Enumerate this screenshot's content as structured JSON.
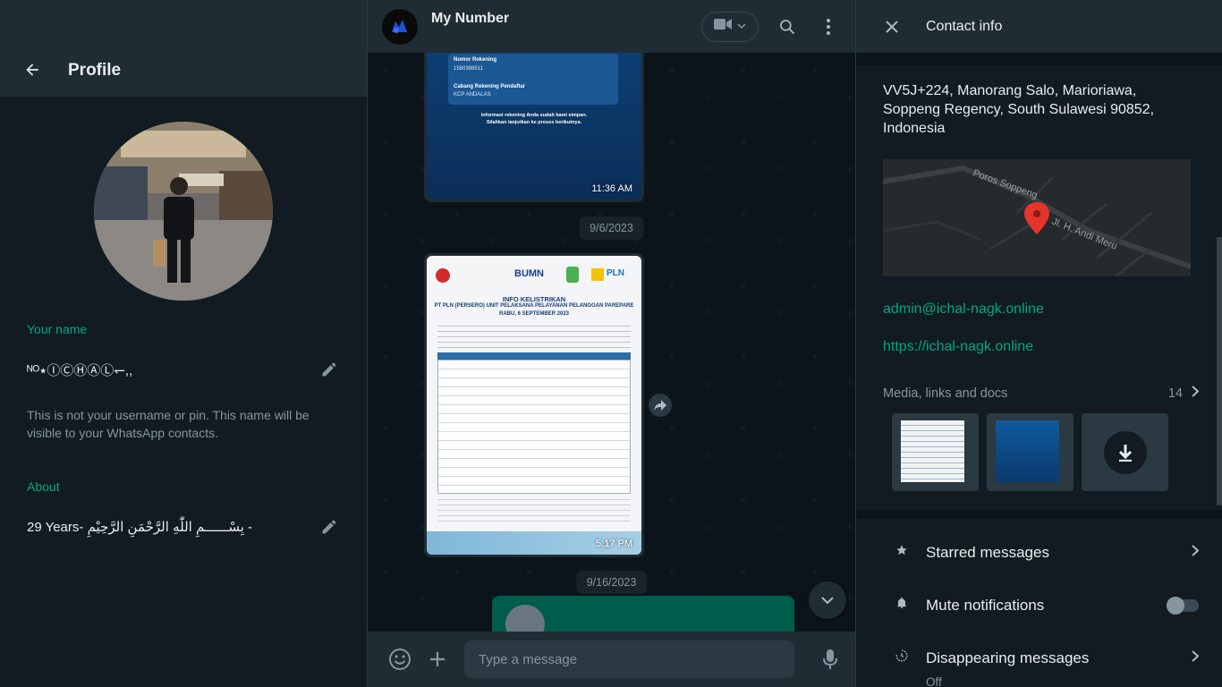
{
  "profile": {
    "title": "Profile",
    "name_label": "Your name",
    "name_value": "ᴺᴼ٭ⒾⒸⒽⒶⓁ↽,,",
    "name_help": "This is not your username or pin. This name will be visible to your WhatsApp contacts.",
    "about_label": "About",
    "about_value": "29 Years- بِسْــــــمِ اللّٰهِ الرَّحْمَنِ الرَّحِيْمِ -"
  },
  "chat": {
    "contact_name": "My Number",
    "messages": [
      {
        "type": "image",
        "time": "11:36 AM",
        "doc_lines": [
          "Nomor Rekening",
          "1580388511",
          "Cabang Rekening Pendaftar",
          "KCP ANDALAS",
          "Informasi rekening Anda sudah kami simpan.",
          "Silahkan lanjutkan ke proses berikutnya."
        ]
      },
      {
        "type": "date",
        "label": "9/6/2023"
      },
      {
        "type": "image",
        "time": "5:17 PM",
        "doc_title": "INFO KELISTRIKAN",
        "doc_subtitle": "PT PLN (PERSERO) UNIT PELAKSANA PELAYANAN PELANGGAN PAREPARE",
        "doc_date": "RABU, 6 SEPTEMBER 2023",
        "brand_bumn": "BUMN",
        "brand_pln": "PLN"
      },
      {
        "type": "date",
        "label": "9/16/2023"
      }
    ],
    "composer_placeholder": "Type a message"
  },
  "info": {
    "title": "Contact info",
    "address": "VV5J+224, Manorang Salo, Marioriawa, Soppeng Regency, South Sulawesi 90852, Indonesia",
    "map_labels": [
      "Poros Soppeng",
      "Jl. H. Andi Meru"
    ],
    "email": "admin@ichal-nagk.online",
    "website": "https://ichal-nagk.online",
    "media_label": "Media, links and docs",
    "media_count": "14",
    "starred": "Starred messages",
    "mute": "Mute notifications",
    "disappearing": "Disappearing messages",
    "disappearing_value": "Off"
  },
  "colors": {
    "accent": "#00a884",
    "panel": "#202c33",
    "bg": "#111b21",
    "outgoing": "#005c4b"
  }
}
